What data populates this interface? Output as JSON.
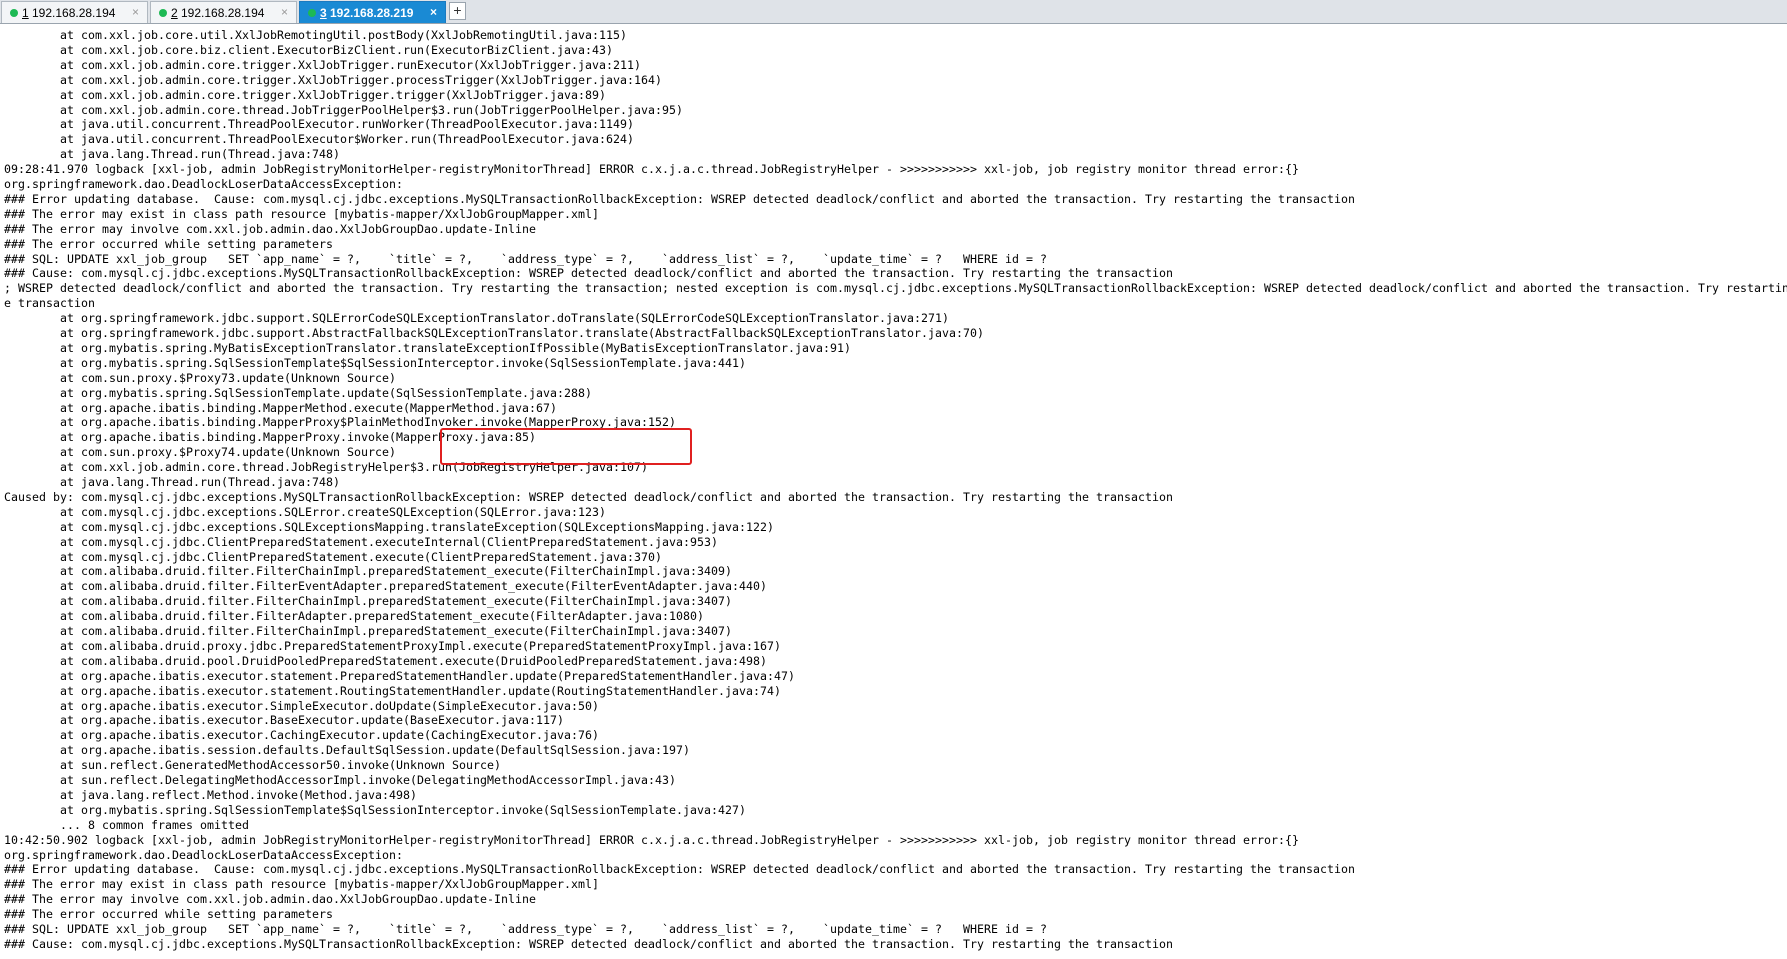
{
  "tabs": [
    {
      "number": "1",
      "label": " 192.168.28.194",
      "close": "×",
      "active": false
    },
    {
      "number": "2",
      "label": " 192.168.28.194",
      "close": "×",
      "active": false
    },
    {
      "number": "3",
      "label": " 192.168.28.219",
      "close": "×",
      "active": true
    }
  ],
  "add_tab_label": "+",
  "colors": {
    "active_tab": "#1a8ad4",
    "status_dot": "#1db954",
    "highlight_border": "#e02020"
  },
  "terminal": {
    "lines": [
      "        at com.xxl.job.core.util.XxlJobRemotingUtil.postBody(XxlJobRemotingUtil.java:115)",
      "        at com.xxl.job.core.biz.client.ExecutorBizClient.run(ExecutorBizClient.java:43)",
      "        at com.xxl.job.admin.core.trigger.XxlJobTrigger.runExecutor(XxlJobTrigger.java:211)",
      "        at com.xxl.job.admin.core.trigger.XxlJobTrigger.processTrigger(XxlJobTrigger.java:164)",
      "        at com.xxl.job.admin.core.trigger.XxlJobTrigger.trigger(XxlJobTrigger.java:89)",
      "        at com.xxl.job.admin.core.thread.JobTriggerPoolHelper$3.run(JobTriggerPoolHelper.java:95)",
      "        at java.util.concurrent.ThreadPoolExecutor.runWorker(ThreadPoolExecutor.java:1149)",
      "        at java.util.concurrent.ThreadPoolExecutor$Worker.run(ThreadPoolExecutor.java:624)",
      "        at java.lang.Thread.run(Thread.java:748)",
      "09:28:41.970 logback [xxl-job, admin JobRegistryMonitorHelper-registryMonitorThread] ERROR c.x.j.a.c.thread.JobRegistryHelper - >>>>>>>>>>> xxl-job, job registry monitor thread error:{}",
      "org.springframework.dao.DeadlockLoserDataAccessException:",
      "### Error updating database.  Cause: com.mysql.cj.jdbc.exceptions.MySQLTransactionRollbackException: WSREP detected deadlock/conflict and aborted the transaction. Try restarting the transaction",
      "### The error may exist in class path resource [mybatis-mapper/XxlJobGroupMapper.xml]",
      "### The error may involve com.xxl.job.admin.dao.XxlJobGroupDao.update-Inline",
      "### The error occurred while setting parameters",
      "### SQL: UPDATE xxl_job_group   SET `app_name` = ?,    `title` = ?,    `address_type` = ?,    `address_list` = ?,    `update_time` = ?   WHERE id = ?",
      "### Cause: com.mysql.cj.jdbc.exceptions.MySQLTransactionRollbackException: WSREP detected deadlock/conflict and aborted the transaction. Try restarting the transaction",
      "; WSREP detected deadlock/conflict and aborted the transaction. Try restarting the transaction; nested exception is com.mysql.cj.jdbc.exceptions.MySQLTransactionRollbackException: WSREP detected deadlock/conflict and aborted the transaction. Try restartin",
      "e transaction",
      "        at org.springframework.jdbc.support.SQLErrorCodeSQLExceptionTranslator.doTranslate(SQLErrorCodeSQLExceptionTranslator.java:271)",
      "        at org.springframework.jdbc.support.AbstractFallbackSQLExceptionTranslator.translate(AbstractFallbackSQLExceptionTranslator.java:70)",
      "        at org.mybatis.spring.MyBatisExceptionTranslator.translateExceptionIfPossible(MyBatisExceptionTranslator.java:91)",
      "        at org.mybatis.spring.SqlSessionTemplate$SqlSessionInterceptor.invoke(SqlSessionTemplate.java:441)",
      "        at com.sun.proxy.$Proxy73.update(Unknown Source)",
      "        at org.mybatis.spring.SqlSessionTemplate.update(SqlSessionTemplate.java:288)",
      "        at org.apache.ibatis.binding.MapperMethod.execute(MapperMethod.java:67)",
      "        at org.apache.ibatis.binding.MapperProxy$PlainMethodInvoker.invoke(MapperProxy.java:152)",
      "        at org.apache.ibatis.binding.MapperProxy.invoke(MapperProxy.java:85)",
      "        at com.sun.proxy.$Proxy74.update(Unknown Source)",
      "        at com.xxl.job.admin.core.thread.JobRegistryHelper$3.run(JobRegistryHelper.java:107)",
      "        at java.lang.Thread.run(Thread.java:748)",
      "Caused by: com.mysql.cj.jdbc.exceptions.MySQLTransactionRollbackException: WSREP detected deadlock/conflict and aborted the transaction. Try restarting the transaction",
      "        at com.mysql.cj.jdbc.exceptions.SQLError.createSQLException(SQLError.java:123)",
      "        at com.mysql.cj.jdbc.exceptions.SQLExceptionsMapping.translateException(SQLExceptionsMapping.java:122)",
      "        at com.mysql.cj.jdbc.ClientPreparedStatement.executeInternal(ClientPreparedStatement.java:953)",
      "        at com.mysql.cj.jdbc.ClientPreparedStatement.execute(ClientPreparedStatement.java:370)",
      "        at com.alibaba.druid.filter.FilterChainImpl.preparedStatement_execute(FilterChainImpl.java:3409)",
      "        at com.alibaba.druid.filter.FilterEventAdapter.preparedStatement_execute(FilterEventAdapter.java:440)",
      "        at com.alibaba.druid.filter.FilterChainImpl.preparedStatement_execute(FilterChainImpl.java:3407)",
      "        at com.alibaba.druid.filter.FilterAdapter.preparedStatement_execute(FilterAdapter.java:1080)",
      "        at com.alibaba.druid.filter.FilterChainImpl.preparedStatement_execute(FilterChainImpl.java:3407)",
      "        at com.alibaba.druid.proxy.jdbc.PreparedStatementProxyImpl.execute(PreparedStatementProxyImpl.java:167)",
      "        at com.alibaba.druid.pool.DruidPooledPreparedStatement.execute(DruidPooledPreparedStatement.java:498)",
      "        at org.apache.ibatis.executor.statement.PreparedStatementHandler.update(PreparedStatementHandler.java:47)",
      "        at org.apache.ibatis.executor.statement.RoutingStatementHandler.update(RoutingStatementHandler.java:74)",
      "        at org.apache.ibatis.executor.SimpleExecutor.doUpdate(SimpleExecutor.java:50)",
      "        at org.apache.ibatis.executor.BaseExecutor.update(BaseExecutor.java:117)",
      "        at org.apache.ibatis.executor.CachingExecutor.update(CachingExecutor.java:76)",
      "        at org.apache.ibatis.session.defaults.DefaultSqlSession.update(DefaultSqlSession.java:197)",
      "        at sun.reflect.GeneratedMethodAccessor50.invoke(Unknown Source)",
      "        at sun.reflect.DelegatingMethodAccessorImpl.invoke(DelegatingMethodAccessorImpl.java:43)",
      "        at java.lang.reflect.Method.invoke(Method.java:498)",
      "        at org.mybatis.spring.SqlSessionTemplate$SqlSessionInterceptor.invoke(SqlSessionTemplate.java:427)",
      "        ... 8 common frames omitted",
      "10:42:50.902 logback [xxl-job, admin JobRegistryMonitorHelper-registryMonitorThread] ERROR c.x.j.a.c.thread.JobRegistryHelper - >>>>>>>>>>> xxl-job, job registry monitor thread error:{}",
      "org.springframework.dao.DeadlockLoserDataAccessException:",
      "### Error updating database.  Cause: com.mysql.cj.jdbc.exceptions.MySQLTransactionRollbackException: WSREP detected deadlock/conflict and aborted the transaction. Try restarting the transaction",
      "### The error may exist in class path resource [mybatis-mapper/XxlJobGroupMapper.xml]",
      "### The error may involve com.xxl.job.admin.dao.XxlJobGroupDao.update-Inline",
      "### The error occurred while setting parameters",
      "### SQL: UPDATE xxl_job_group   SET `app_name` = ?,    `title` = ?,    `address_type` = ?,    `address_list` = ?,    `update_time` = ?   WHERE id = ?",
      "### Cause: com.mysql.cj.jdbc.exceptions.MySQLTransactionRollbackException: WSREP detected deadlock/conflict and aborted the transaction. Try restarting the transaction"
    ]
  }
}
